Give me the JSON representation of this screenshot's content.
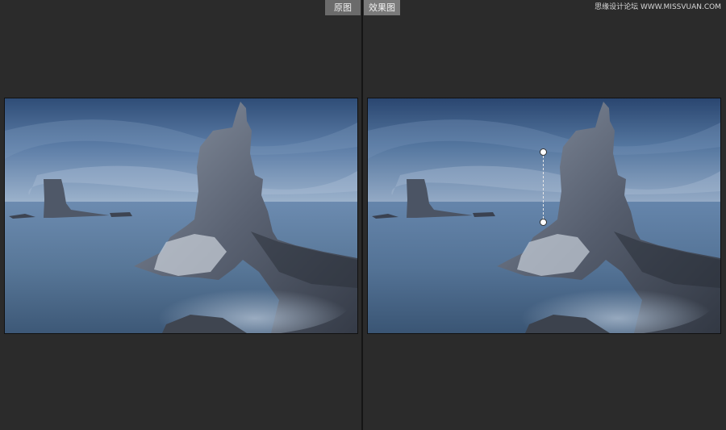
{
  "toolbar": {
    "before_label": "原图",
    "after_label": "效果图"
  },
  "watermark": {
    "text": "思缘设计论坛 WWW.MISSVUAN.COM"
  },
  "panels": {
    "before": {
      "icon": "landscape-photo"
    },
    "after": {
      "icon": "landscape-photo"
    }
  },
  "colors": {
    "background": "#2b2b2b",
    "divider": "#141414",
    "sky": "#4a6b95",
    "sea": "#5d7a9e",
    "rock": "#4f5868"
  }
}
